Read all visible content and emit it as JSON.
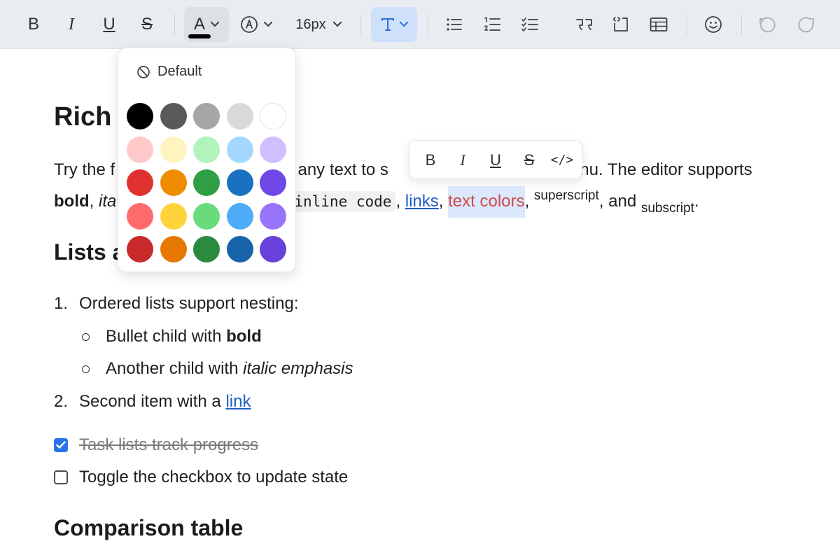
{
  "toolbar": {
    "buttons": [
      {
        "name": "bold-button",
        "label": "B"
      },
      {
        "name": "italic-button",
        "label": "I"
      },
      {
        "name": "underline-button",
        "label": "U"
      },
      {
        "name": "strikethrough-button",
        "label": "S"
      }
    ],
    "text_color_label": "A",
    "current_text_color": "#000000",
    "font_size_value": "16px"
  },
  "color_picker": {
    "default_label": "Default",
    "rows": [
      [
        "#000000",
        "#595959",
        "#a6a6a6",
        "#d9d9d9",
        "#ffffff"
      ],
      [
        "#ffc9c9",
        "#fff3bf",
        "#b2f2bb",
        "#a5d8ff",
        "#d0bfff"
      ],
      [
        "#e03131",
        "#f08c00",
        "#2f9e44",
        "#1971c2",
        "#7048e8"
      ],
      [
        "#ff6b6b",
        "#ffd43b",
        "#69db7c",
        "#4dabf7",
        "#9775fa"
      ],
      [
        "#c92a2a",
        "#e67700",
        "#2b8a3e",
        "#1864ab",
        "#6741d9"
      ]
    ]
  },
  "bubble_menu": {
    "bold": "B",
    "italic": "I",
    "underline": "U",
    "strike": "S",
    "code": "</>"
  },
  "document": {
    "title": "Rich T",
    "para": {
      "line1_a": "Try the f",
      "line1_b": "t any text to s",
      "line1_c": "enu. The editor supports",
      "bold": "bold",
      "comma1": ",",
      "italic": "ita",
      "code": "inline code",
      "comma2": ",",
      "link": "links",
      "comma3": ",",
      "color_text": "text colors",
      "comma4": ",",
      "superscript": "superscript",
      "and": ", and",
      "subscript": "subscript",
      "period": "."
    },
    "lists_heading": "Lists a",
    "ordered": [
      {
        "num": "1.",
        "text": "Ordered lists support nesting:"
      },
      {
        "num": "2.",
        "text": "Second item with a ",
        "link": "link"
      }
    ],
    "bullets": [
      {
        "text": "Bullet child with ",
        "bold": "bold"
      },
      {
        "text": "Another child with ",
        "italic": "italic emphasis"
      }
    ],
    "tasks": [
      {
        "text": "Task lists track progress",
        "checked": true
      },
      {
        "text": "Toggle the checkbox to update state",
        "checked": false
      }
    ],
    "table_heading": "Comparison table"
  }
}
